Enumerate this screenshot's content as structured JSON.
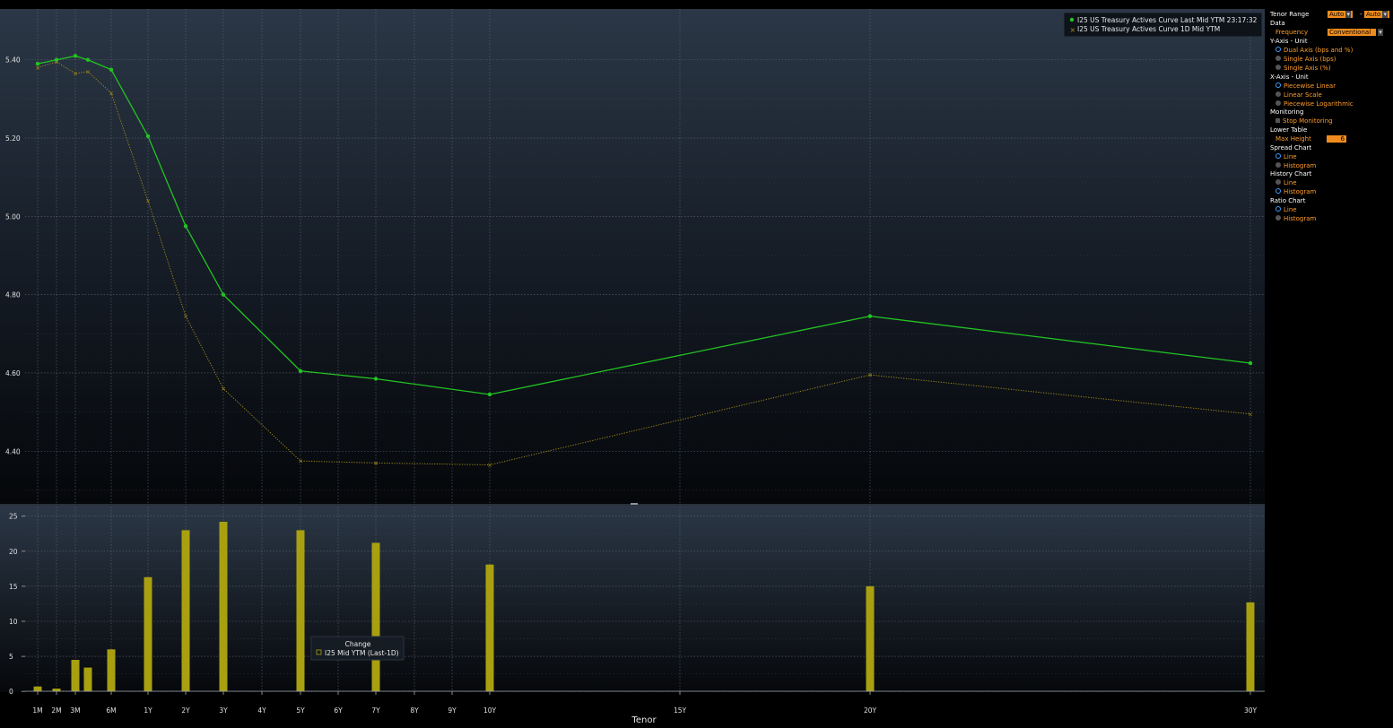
{
  "chart_data": [
    {
      "type": "line",
      "tenors": [
        "1M",
        "2M",
        "3M",
        "4M",
        "6M",
        "1Y",
        "2Y",
        "3Y",
        "5Y",
        "7Y",
        "10Y",
        "20Y",
        "30Y"
      ],
      "x_years": [
        0.083,
        0.167,
        0.25,
        0.333,
        0.5,
        1,
        2,
        3,
        5,
        7,
        10,
        20,
        30
      ],
      "series": [
        {
          "name": "I25 US Treasury Actives Curve Last Mid YTM 23:17:32",
          "color": "#22c422",
          "style": "solid",
          "values": [
            5.39,
            5.4,
            5.41,
            5.4,
            5.375,
            5.205,
            4.975,
            4.8,
            4.605,
            4.585,
            4.545,
            4.745,
            4.625
          ]
        },
        {
          "name": "I25 US Treasury Actives Curve 1D Mid YTM",
          "color": "#a08a1a",
          "style": "dotted",
          "values": [
            5.38,
            5.395,
            5.365,
            5.37,
            5.315,
            5.04,
            4.745,
            4.56,
            4.375,
            4.37,
            4.365,
            4.595,
            4.495
          ]
        }
      ],
      "ylim": [
        4.27,
        5.53
      ],
      "yticks": [
        "5.40",
        "5.20",
        "5.00",
        "4.80",
        "4.60",
        "4.40"
      ],
      "ytick_values": [
        5.4,
        5.2,
        5.0,
        4.8,
        4.6,
        4.4
      ],
      "grid": true,
      "legend_position": "top-right"
    },
    {
      "type": "bar",
      "series": [
        {
          "name": "I25 Mid YTM (Last-1D)",
          "color": "#a8a010",
          "values": [
            0.7,
            0.4,
            4.5,
            3.4,
            6.0,
            16.3,
            23.0,
            24.2,
            23.0,
            21.2,
            18.1,
            15.0,
            12.7
          ]
        }
      ],
      "ylim": [
        -1,
        26.5
      ],
      "yticks": [
        "25",
        "20",
        "15",
        "10",
        "5",
        "0"
      ],
      "ytick_values": [
        25,
        20,
        15,
        10,
        5,
        0
      ],
      "legend_title": "Change",
      "legend_label": "I25 Mid YTM (Last-1D)"
    }
  ],
  "x_axis": {
    "label": "Tenor",
    "tick_labels": [
      "1M",
      "2M",
      "3M",
      "6M",
      "1Y",
      "2Y",
      "3Y",
      "4Y",
      "5Y",
      "6Y",
      "7Y",
      "8Y",
      "9Y",
      "10Y",
      "15Y",
      "20Y",
      "30Y"
    ],
    "tick_years": [
      0.083,
      0.167,
      0.25,
      0.5,
      1,
      2,
      3,
      4,
      5,
      6,
      7,
      8,
      9,
      10,
      15,
      20,
      30
    ]
  },
  "settings": {
    "tenor_range_label": "Tenor Range",
    "tenor_from": "Auto",
    "tenor_sep": "-",
    "tenor_to": "Auto",
    "data_label": "Data",
    "frequency_label": "Frequency",
    "frequency_value": "Conventional",
    "yaxis_label": "Y-Axis - Unit",
    "yaxis_options": [
      {
        "label": "Dual Axis (bps and %)",
        "selected": true
      },
      {
        "label": "Single Axis (bps)",
        "selected": false
      },
      {
        "label": "Single Axis (%)",
        "selected": false
      }
    ],
    "xaxis_label": "X-Axis - Unit",
    "xaxis_options": [
      {
        "label": "Piecewise Linear",
        "selected": true
      },
      {
        "label": "Linear Scale",
        "selected": false
      },
      {
        "label": "Piecewise Logarithmic",
        "selected": false
      }
    ],
    "monitoring_label": "Monitoring",
    "stop_monitoring_label": "Stop Monitoring",
    "lower_table_label": "Lower Table",
    "max_height_label": "Max Height",
    "max_height_value": "6",
    "spread_chart_label": "Spread Chart",
    "spread_options": [
      {
        "label": "Line",
        "selected": true
      },
      {
        "label": "Histogram",
        "selected": false
      }
    ],
    "history_chart_label": "History Chart",
    "history_options": [
      {
        "label": "Line",
        "selected": false
      },
      {
        "label": "Histogram",
        "selected": true
      }
    ],
    "ratio_chart_label": "Ratio Chart",
    "ratio_options": [
      {
        "label": "Line",
        "selected": true
      },
      {
        "label": "Histogram",
        "selected": false
      }
    ]
  }
}
